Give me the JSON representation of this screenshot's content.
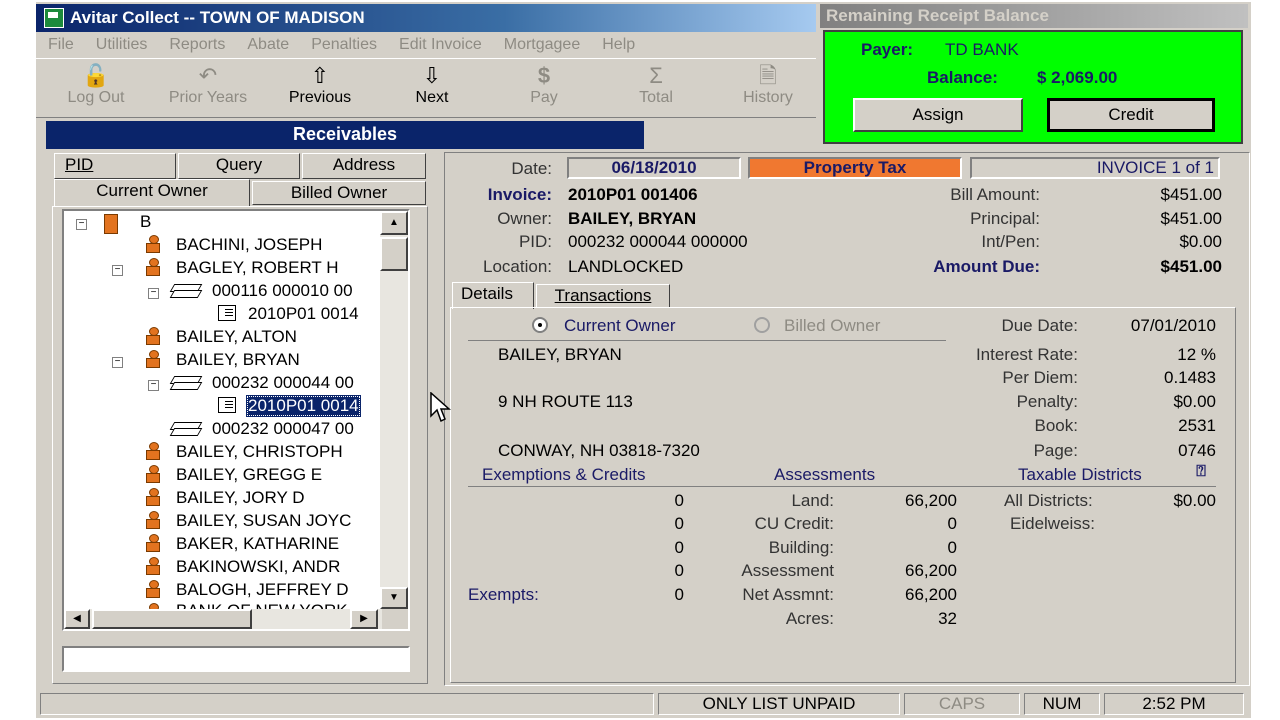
{
  "window": {
    "title": "Avitar Collect -- TOWN OF MADISON"
  },
  "menu": [
    "File",
    "Utilities",
    "Reports",
    "Abate",
    "Penalties",
    "Edit Invoice",
    "Mortgagee",
    "Help"
  ],
  "toolbar": {
    "logout": "Log Out",
    "prior_years": "Prior Years",
    "previous": "Previous",
    "next": "Next",
    "pay": "Pay",
    "total": "Total",
    "history": "History"
  },
  "receipt": {
    "title": "Remaining Receipt Balance",
    "payer_label": "Payer:",
    "payer": "TD BANK",
    "balance_label": "Balance:",
    "balance": "$ 2,069.00",
    "assign": "Assign",
    "credit": "Credit"
  },
  "receivables": {
    "title": "Receivables",
    "tabs_top": [
      "PID",
      "Query",
      "Address"
    ],
    "tabs_bottom": [
      "Current Owner",
      "Billed Owner"
    ],
    "tree": [
      {
        "text": "B"
      },
      {
        "text": "BACHINI, JOSEPH"
      },
      {
        "text": "BAGLEY, ROBERT H"
      },
      {
        "text": "000116 000010 00"
      },
      {
        "text": "2010P01 0014"
      },
      {
        "text": "BAILEY, ALTON"
      },
      {
        "text": "BAILEY, BRYAN"
      },
      {
        "text": "000232 000044 00"
      },
      {
        "text": "2010P01 0014"
      },
      {
        "text": "000232 000047 00"
      },
      {
        "text": "BAILEY, CHRISTOPH"
      },
      {
        "text": "BAILEY, GREGG E"
      },
      {
        "text": "BAILEY, JORY D"
      },
      {
        "text": "BAILEY, SUSAN JOYC"
      },
      {
        "text": "BAKER, KATHARINE"
      },
      {
        "text": "BAKINOWSKI, ANDR"
      },
      {
        "text": "BALOGH, JEFFREY D"
      },
      {
        "text": "BANK OF NEW YORK"
      }
    ]
  },
  "invoice": {
    "date_label": "Date:",
    "date": "06/18/2010",
    "tax_type": "Property Tax",
    "invoice_count": "INVOICE 1 of 1",
    "invoice_label": "Invoice:",
    "invoice": "2010P01 001406",
    "owner_label": "Owner:",
    "owner": "BAILEY, BRYAN",
    "pid_label": "PID:",
    "pid": "000232 000044 000000",
    "location_label": "Location:",
    "location": "LANDLOCKED",
    "bill_amount_label": "Bill Amount:",
    "bill_amount": "$451.00",
    "principal_label": "Principal:",
    "principal": "$451.00",
    "intpen_label": "Int/Pen:",
    "intpen": "$0.00",
    "amount_due_label": "Amount Due:",
    "amount_due": "$451.00"
  },
  "details": {
    "tabs": [
      "Details",
      "Transactions"
    ],
    "current_owner": "Current Owner",
    "billed_owner": "Billed Owner",
    "addr1": "BAILEY, BRYAN",
    "addr2": "9 NH ROUTE 113",
    "addr3": "CONWAY, NH  03818-7320",
    "due_date_label": "Due Date:",
    "due_date": "07/01/2010",
    "interest_rate_label": "Interest Rate:",
    "interest_rate": "12 %",
    "per_diem_label": "Per Diem:",
    "per_diem": "0.1483",
    "penalty_label": "Penalty:",
    "penalty": "$0.00",
    "book_label": "Book:",
    "book": "2531",
    "page_label": "Page:",
    "page": "0746",
    "exemptions_header": "Exemptions & Credits",
    "assessments_header": "Assessments",
    "districts_header": "Taxable Districts",
    "exempt_values": [
      "0",
      "0",
      "0",
      "0",
      "0"
    ],
    "exempts_label": "Exempts:",
    "land_label": "Land:",
    "land": "66,200",
    "cu_label": "CU Credit:",
    "cu": "0",
    "building_label": "Building:",
    "building": "0",
    "assessment_label": "Assessment",
    "assessment": "66,200",
    "net_label": "Net Assmnt:",
    "net": "66,200",
    "acres_label": "Acres:",
    "acres": "32",
    "all_districts_label": "All Districts:",
    "all_districts": "$0.00",
    "eidelweiss_label": "Eidelweiss:"
  },
  "status": {
    "filter": "ONLY LIST UNPAID",
    "caps": "CAPS",
    "num": "NUM",
    "time": "2:52 PM"
  },
  "colors": {
    "green": "#00ff00",
    "title_blue": "#0a246a",
    "orange": "#f07830",
    "grey": "#d4d0c8"
  }
}
